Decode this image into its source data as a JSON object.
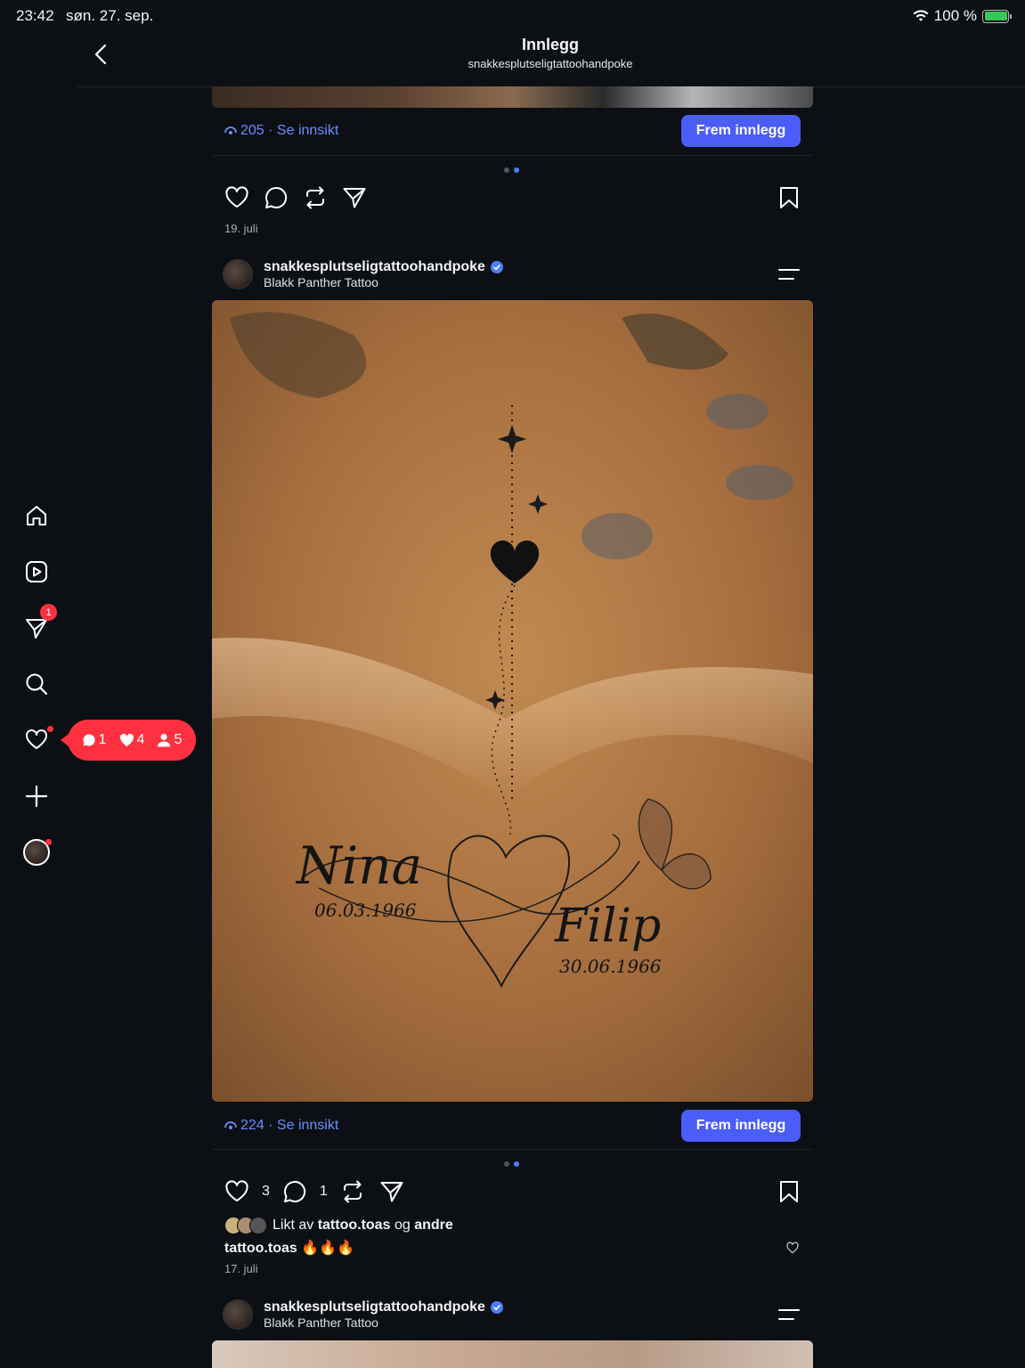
{
  "status_bar": {
    "time": "23:42",
    "date": "søn. 27. sep.",
    "battery": "100 %"
  },
  "header": {
    "title": "Innlegg",
    "subtitle": "snakkesplutseligtattoohandpoke"
  },
  "sidebar": {
    "messages_badge": "1",
    "items": [
      "home-icon",
      "reels-icon",
      "messages-icon",
      "search-icon",
      "notifications-icon",
      "create-icon",
      "profile-icon"
    ]
  },
  "notifications_bubble": {
    "comments": "1",
    "likes": "4",
    "follows": "5"
  },
  "posts": [
    {
      "views": "205",
      "insight_label": "· Se innsikt",
      "promote_label": "Frem innlegg",
      "date": "19. juli"
    },
    {
      "username": "snakkesplutseligtattoohandpoke",
      "location": "Blakk Panther Tattoo",
      "views": "224",
      "insight_label": "· Se innsikt",
      "promote_label": "Frem innlegg",
      "like_count": "3",
      "comment_count": "1",
      "liked_by_prefix": "Likt av",
      "liked_by_user": "tattoo.toas",
      "liked_by_conj": "og",
      "liked_by_others": "andre",
      "comment_user": "tattoo.toas",
      "comment_text": "🔥🔥🔥",
      "date": "17. juli",
      "tattoo_name_left": "Nina",
      "tattoo_date_left": "06.03.1966",
      "tattoo_name_right": "Filip",
      "tattoo_date_right": "30.06.1966"
    },
    {
      "username": "snakkesplutseligtattoohandpoke",
      "location": "Blakk Panther Tattoo"
    }
  ],
  "colors": {
    "accent": "#4a5df9",
    "link": "#6c8cff",
    "badge": "#ff3040",
    "background": "#0c1014"
  }
}
